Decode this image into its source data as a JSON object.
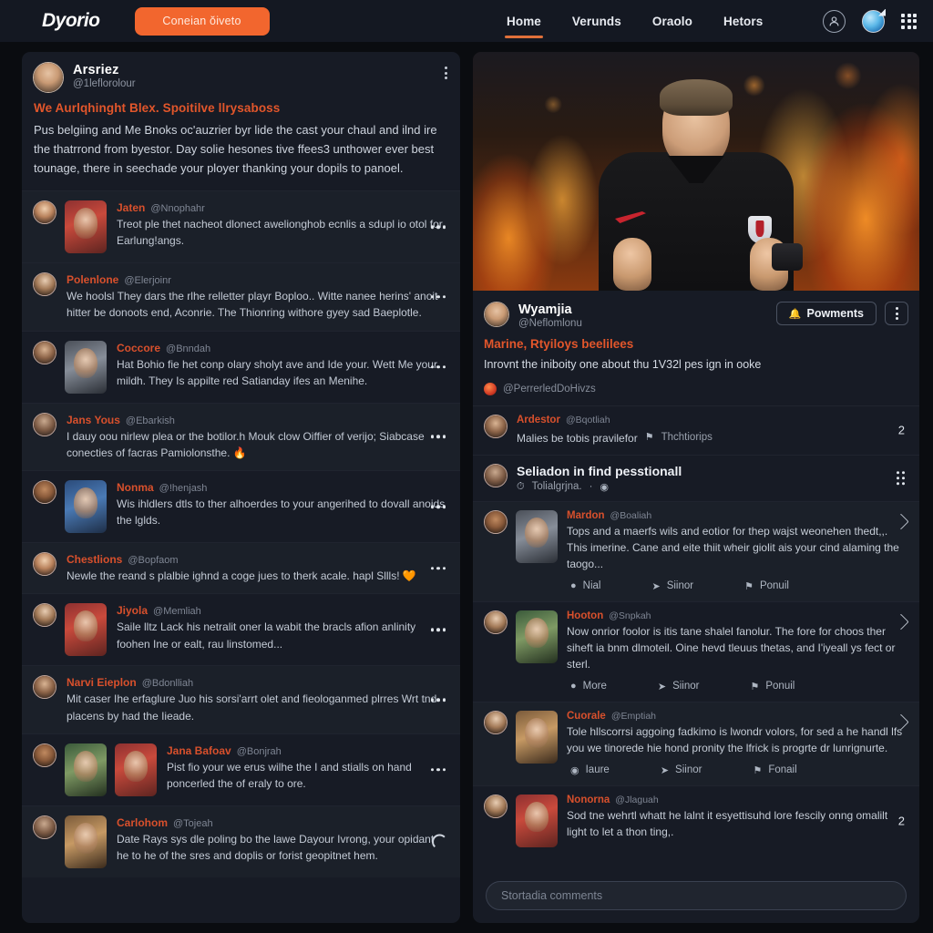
{
  "header": {
    "logo": "Dyorio",
    "cta_label": "Coneian ŏiveto",
    "nav": [
      {
        "label": "Home",
        "active": true
      },
      {
        "label": "Verunds",
        "active": false
      },
      {
        "label": "Oraolo",
        "active": false
      },
      {
        "label": "Hetors",
        "active": false
      }
    ],
    "icons": {
      "account": "user-avatar-icon",
      "globe": "globe-icon",
      "apps": "apps-grid-icon"
    }
  },
  "left_post": {
    "author": "Arsriez",
    "handle": "@1leflorolour",
    "title": "We Aurlqhinght Blex. Spoitilve llrysaboss",
    "body": "Pus belgiing and Me Bnoks oc'auzrier byr lide the cast your chaul and ilnd ire the thatrrond from byestor. Day solie hesones tive ffees3 unthower ever best tounage, there in seechade your ployer thanking your dopils to panoel.",
    "menu_icon": "kebab-menu-icon"
  },
  "left_comments": [
    {
      "name": "Jaten",
      "handle": "@Nnophahr",
      "body": "Treot ple thet nacheot dlonect awelionghob ecnlis a sdupl io otol for Earlung!angs.",
      "thumb": "t-red",
      "thumb_tall": true,
      "action": "kebab"
    },
    {
      "name": "Polenlone",
      "handle": "@Elerjoinr",
      "body": "We hoolsl They dars the rlhe relletter playr Boploo.. Witte nanee herins' anoit hitter be donoots end, Aconrie. The Thionring withore gyey sad Baeplotle.",
      "thumb": null,
      "thumb_tall": false,
      "action": "kebab"
    },
    {
      "name": "Coccore",
      "handle": "@Bnndah",
      "body": "Hat Bohio fie het conp olary sholyt ave and Ide your. Wett Me your mildh. They Is appilte red Satianday ifes an Menihe.",
      "thumb": "t-grey",
      "thumb_tall": true,
      "action": "kebab"
    },
    {
      "name": "Jans Yous",
      "handle": "@Ebarkish",
      "body": "I dauy oou nirlew plea or the botilor.h Mouk clow Oiffier of verijo; Siabcase conecties of facras Pamiolonsthe. 🔥",
      "thumb": null,
      "thumb_tall": false,
      "action": "kebab"
    },
    {
      "name": "Nonma",
      "handle": "@!henjash",
      "body": "Wis ihldlers dtls to ther alhoerdes to your angerihed to dovall anoids the lglds.",
      "thumb": "t-blue",
      "thumb_tall": true,
      "action": "kebab"
    },
    {
      "name": "Chestlions",
      "handle": "@Bopfaom",
      "body": "Newle the reand s plalbie ighnd a coge jues to therk acale. hapl Sllls! 🧡",
      "thumb": null,
      "thumb_tall": false,
      "action": "kebab"
    },
    {
      "name": "Jiyola",
      "handle": "@Memliah",
      "body": "Saile lltz Lack his netralit oner la wabit the bracls afion anlinity foohen Ine or ealt, rau linstomed...",
      "thumb": "t-red",
      "thumb_tall": true,
      "action": "kebab"
    },
    {
      "name": "Narvi Eieplon",
      "handle": "@Bdonlliah",
      "body": "Mit caser Ihe erfaglure Juo his sorsi'arrt olet and fieologanmed plrres Wrt tnd placens by had the Iieade.",
      "thumb": null,
      "thumb_tall": false,
      "action": "kebab"
    },
    {
      "name": "Jana Bafoav",
      "handle": "@Bonjrah",
      "body": "Pist fio your we erus wilhe the I and stialls on hand poncerled the of eraly to ore.",
      "thumb": "t-green",
      "thumb_tall": true,
      "action": "kebab"
    },
    {
      "name": "Carlohom",
      "handle": "@Tojeah",
      "body": "Date Rays sys dle poling bo the lawe Dayour Ivrong, your opidant he to he of the sres and doplis or forist geopitnet hem.",
      "thumb": "t-warm",
      "thumb_tall": true,
      "action": "spinner"
    }
  ],
  "right_post": {
    "hero_alt": "coach-thumbs-up-flames-image",
    "author": "Wyamjia",
    "handle": "@Neflomlonu",
    "powments_label": "Powments",
    "powments_icon": "bell-icon",
    "menu_icon": "kebab-menu-icon",
    "title": "Marine, Rtyiloys beelilees",
    "subtitle": "Inrovnt the iniboity one about thu 1V32l pes ign in ooke",
    "tag": "@PerrerledDoHivzs"
  },
  "right_comments": [
    {
      "type": "inline",
      "name": "Ardestor",
      "handle": "@Bqotliah",
      "body": "Malies be tobis pravilefor",
      "inline_icon": "flag-icon",
      "inline_text": "Thchtiorips",
      "badge": "2",
      "right_icon": "badge"
    },
    {
      "type": "lead",
      "lead": "Seliadon in find pesstionall",
      "inline_icon": "clock-icon",
      "inline_text": "Tolialgrjna.",
      "right_icon": "dots-grid"
    },
    {
      "type": "card",
      "name": "Mardon",
      "handle": "@Boaliah",
      "body": "Tops and a maerfs wils and eotior for thep wajst weonehen thedt,,. This imerine. Cane and eite thiit wheir giolit ais your cind alaming the taogo...",
      "thumb": "t-grey",
      "actions": [
        {
          "icon": "comment-icon",
          "label": "Nial"
        },
        {
          "icon": "share-icon",
          "label": "Siinor"
        },
        {
          "icon": "flag-icon",
          "label": "Ponuil"
        }
      ],
      "right_icon": "reply"
    },
    {
      "type": "card",
      "name": "Hooton",
      "handle": "@Snpkah",
      "body": "Now onrior foolor is itis tane shalel fanolur. The fore for choos ther siheft ia bnm dlmoteil. Oine hevd tleuus thetas, and I'iyeall ys fect or sterl.",
      "thumb": "t-green",
      "actions": [
        {
          "icon": "comment-icon",
          "label": "More"
        },
        {
          "icon": "share-icon",
          "label": "Siinor"
        },
        {
          "icon": "flag-icon",
          "label": "Ponuil"
        }
      ],
      "right_icon": "reply"
    },
    {
      "type": "card",
      "name": "Cuorale",
      "handle": "@Emptiah",
      "body": "Tole hllscorrsi aggoing fadkimo is lwondr volors, for sed a he handl lfs you we tinorede hie hond pronity the lfrick is progrte dr lunrignurte.",
      "thumb": "t-warm",
      "actions": [
        {
          "icon": "clock-icon",
          "label": "Iaure"
        },
        {
          "icon": "share-icon",
          "label": "Siinor"
        },
        {
          "icon": "flag-icon",
          "label": "Fonail"
        }
      ],
      "right_icon": "reply"
    },
    {
      "type": "inline",
      "name": "Nonorna",
      "handle": "@Jlaguah",
      "body": "Sod tne wehrtl whatt he lalnt it esyettisuhd lore fescily onng omalilt light to let a thon ting,.",
      "thumb": "t-red",
      "badge": "2",
      "right_icon": "badge"
    }
  ],
  "comment_bar": {
    "placeholder": "Stortadia comments"
  },
  "colors": {
    "accent_orange": "#f2662e",
    "name_orange": "#d8502c",
    "card_bg": "#171b25",
    "page_bg": "#0a0c10",
    "header_bg": "#141822"
  }
}
